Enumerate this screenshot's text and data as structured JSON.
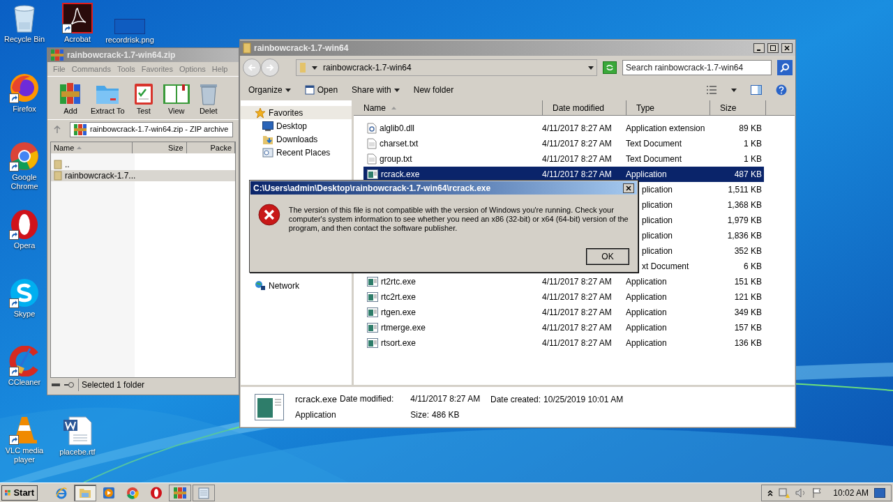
{
  "desktop_column": [
    {
      "label": "Recycle Bin",
      "kind": "recycle",
      "shortcut": false
    },
    {
      "label": "Firefox",
      "kind": "firefox",
      "shortcut": true
    },
    {
      "label": "Google Chrome",
      "kind": "chrome",
      "shortcut": true
    },
    {
      "label": "Opera",
      "kind": "opera",
      "shortcut": true
    },
    {
      "label": "Skype",
      "kind": "skype",
      "shortcut": true
    },
    {
      "label": "CCleaner",
      "kind": "ccleaner",
      "shortcut": true
    },
    {
      "label": "VLC media player",
      "kind": "vlc",
      "shortcut": true
    }
  ],
  "desktop_extra": [
    {
      "label": "Acrobat",
      "kind": "acrobat",
      "shortcut": true
    },
    {
      "label": "recordrisk.png",
      "kind": "blank",
      "shortcut": false
    },
    {
      "label": "placebe.rtf",
      "kind": "word",
      "shortcut": false
    }
  ],
  "archiver": {
    "title": "rainbowcrack-1.7-win64.zip",
    "menu": [
      "File",
      "Commands",
      "Tools",
      "Favorites",
      "Options",
      "Help"
    ],
    "tools": [
      {
        "label": "Add",
        "kind": "add"
      },
      {
        "label": "Extract To",
        "kind": "extract"
      },
      {
        "label": "Test",
        "kind": "test"
      },
      {
        "label": "View",
        "kind": "view"
      },
      {
        "label": "Delet",
        "kind": "delete"
      }
    ],
    "address": "rainbowcrack-1.7-win64.zip - ZIP archive",
    "columns": [
      "Name",
      "Size",
      "Packe"
    ],
    "rows": [
      {
        "name": "..",
        "selected": false
      },
      {
        "name": "rainbowcrack-1.7...",
        "selected": true
      }
    ],
    "status": "Selected 1 folder"
  },
  "explorer": {
    "title": "rainbowcrack-1.7-win64",
    "path": "rainbowcrack-1.7-win64",
    "search": {
      "placeholder": "Search rainbowcrack-1.7-win64"
    },
    "commands": [
      {
        "label": "Organize",
        "kind": "menu"
      },
      {
        "label": "Open",
        "kind": "open"
      },
      {
        "label": "Share with",
        "kind": "menu"
      },
      {
        "label": "New folder",
        "kind": "plain"
      }
    ],
    "sidebar": [
      {
        "label": "Favorites",
        "kind": "star",
        "selected": true,
        "children": [
          {
            "label": "Desktop",
            "kind": "desktop",
            "selected": false
          },
          {
            "label": "Downloads",
            "kind": "downloads",
            "selected": false
          },
          {
            "label": "Recent Places",
            "kind": "recent",
            "selected": false
          }
        ]
      },
      {
        "label": "Network",
        "kind": "network",
        "selected": false
      }
    ],
    "columns": [
      "Name",
      "Date modified",
      "Type",
      "Size"
    ],
    "rows": [
      {
        "name": "alglib0.dll",
        "kind": "dll",
        "date": "4/11/2017 8:27 AM",
        "type": "Application extension",
        "size": "89 KB",
        "selected": false
      },
      {
        "name": "charset.txt",
        "kind": "txt",
        "date": "4/11/2017 8:27 AM",
        "type": "Text Document",
        "size": "1 KB",
        "selected": false
      },
      {
        "name": "group.txt",
        "kind": "txt",
        "date": "4/11/2017 8:27 AM",
        "type": "Text Document",
        "size": "1 KB",
        "selected": false
      },
      {
        "name": "rcrack.exe",
        "kind": "exe",
        "date": "4/11/2017 8:27 AM",
        "type": "Application",
        "size": "487 KB",
        "selected": true
      },
      {
        "type": "plication",
        "size": "1,511 KB",
        "selected": false
      },
      {
        "type": "plication",
        "size": "1,368 KB",
        "selected": false
      },
      {
        "type": "plication",
        "size": "1,979 KB",
        "selected": false
      },
      {
        "type": "plication",
        "size": "1,836 KB",
        "selected": false
      },
      {
        "type": "plication",
        "size": "352 KB",
        "selected": false
      },
      {
        "type": "xt Document",
        "size": "6 KB",
        "selected": false
      },
      {
        "name": "rt2rtc.exe",
        "kind": "exe",
        "date": "4/11/2017 8:27 AM",
        "type": "Application",
        "size": "151 KB",
        "selected": false
      },
      {
        "name": "rtc2rt.exe",
        "kind": "exe",
        "date": "4/11/2017 8:27 AM",
        "type": "Application",
        "size": "121 KB",
        "selected": false
      },
      {
        "name": "rtgen.exe",
        "kind": "exe",
        "date": "4/11/2017 8:27 AM",
        "type": "Application",
        "size": "349 KB",
        "selected": false
      },
      {
        "name": "rtmerge.exe",
        "kind": "exe",
        "date": "4/11/2017 8:27 AM",
        "type": "Application",
        "size": "157 KB",
        "selected": false
      },
      {
        "name": "rtsort.exe",
        "kind": "exe",
        "date": "4/11/2017 8:27 AM",
        "type": "Application",
        "size": "136 KB",
        "selected": false
      }
    ],
    "details": {
      "name": "rcrack.exe",
      "type": "Application",
      "modified_label": "Date modified:",
      "modified": "4/11/2017 8:27 AM",
      "created_label": "Date created:",
      "created": "10/25/2019 10:01 AM",
      "size_label": "Size:",
      "size": "486 KB"
    }
  },
  "dialog": {
    "title": "C:\\Users\\admin\\Desktop\\rainbowcrack-1.7-win64\\rcrack.exe",
    "message": "The version of this file is not compatible with the version of Windows you're running. Check your computer's system information to see whether you need an x86 (32-bit) or x64 (64-bit) version of the program, and then contact the software publisher.",
    "button": "OK"
  },
  "taskbar": {
    "start": "Start",
    "apps": [
      {
        "kind": "ie",
        "selected": false,
        "running": false
      },
      {
        "kind": "explorer",
        "selected": true,
        "running": true
      },
      {
        "kind": "media",
        "selected": false,
        "running": false
      },
      {
        "kind": "chrome",
        "selected": false,
        "running": false
      },
      {
        "kind": "opera",
        "selected": false,
        "running": false
      },
      {
        "kind": "winrar",
        "selected": false,
        "running": true
      },
      {
        "kind": "notepad",
        "selected": false,
        "running": true
      }
    ],
    "clock": "10:02 AM"
  }
}
